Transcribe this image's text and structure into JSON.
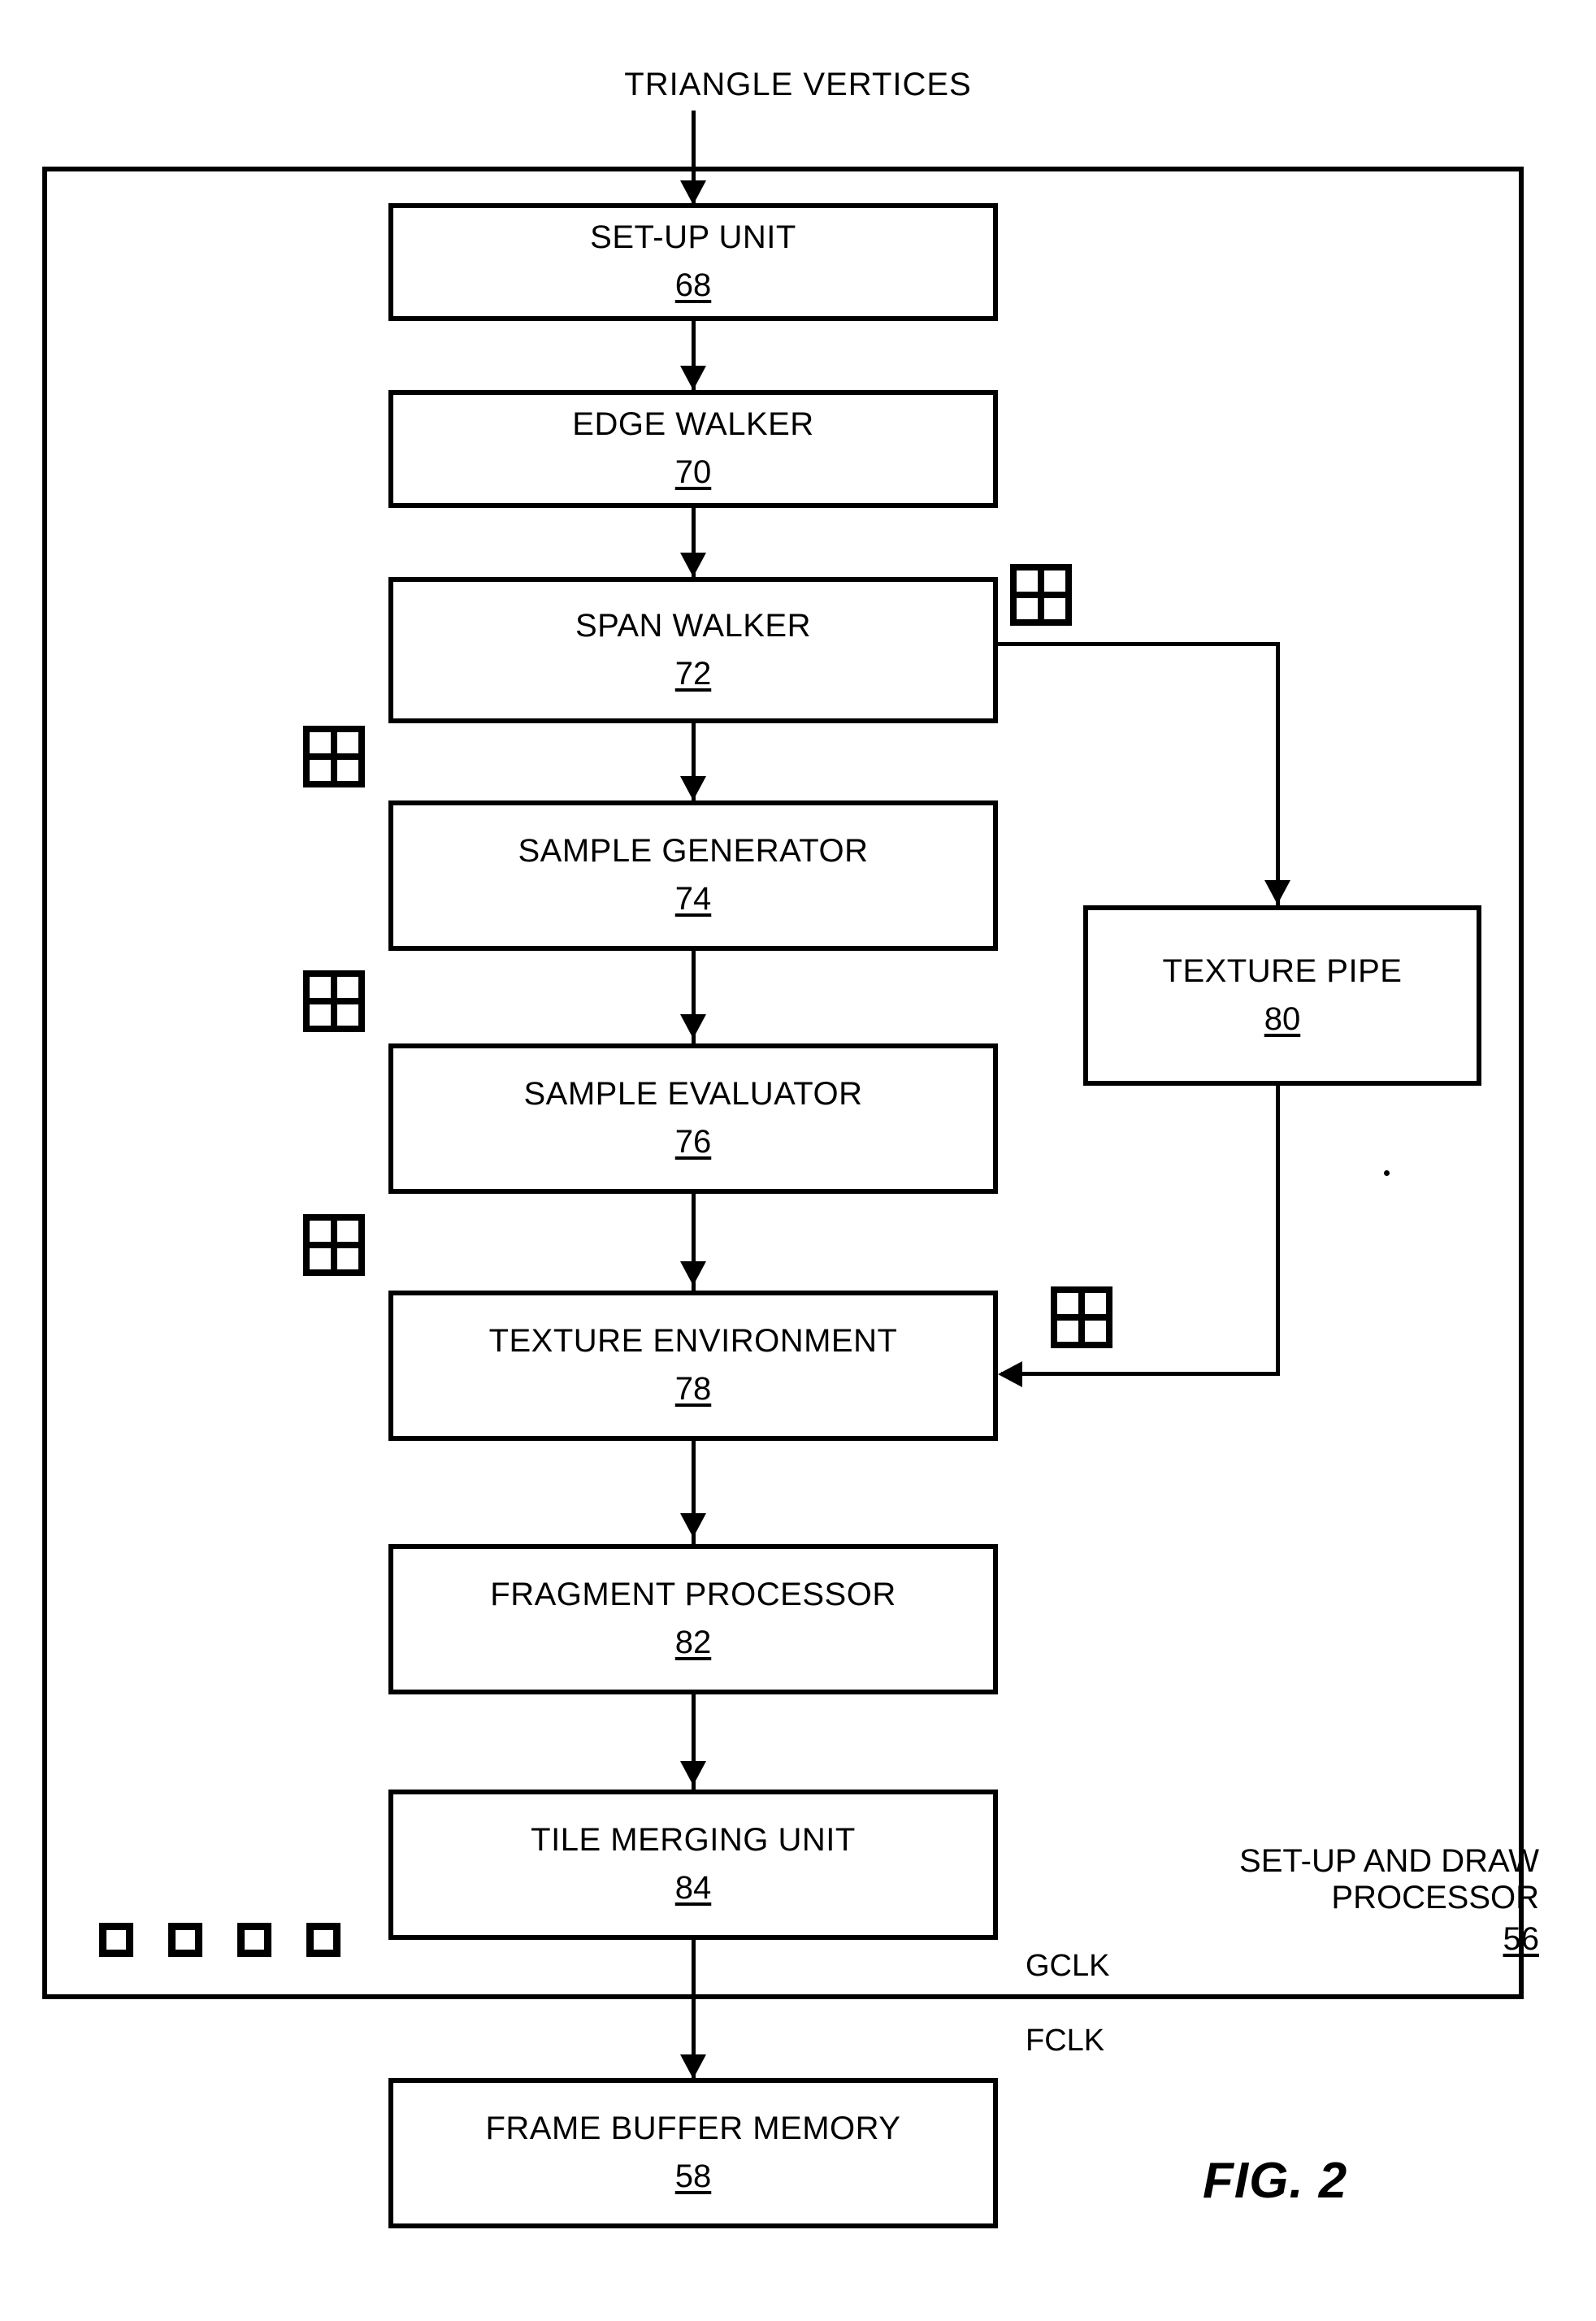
{
  "figure": {
    "caption": "FIG. 2",
    "input_label": "TRIANGLE VERTICES"
  },
  "container": {
    "label_line1": "SET-UP AND DRAW",
    "label_line2": "PROCESSOR",
    "ref_number": "56"
  },
  "clocks": {
    "gclk": "GCLK",
    "fclk": "FCLK"
  },
  "blocks": [
    {
      "title": "SET-UP UNIT",
      "ref": "68"
    },
    {
      "title": "EDGE WALKER",
      "ref": "70"
    },
    {
      "title": "SPAN WALKER",
      "ref": "72"
    },
    {
      "title": "SAMPLE GENERATOR",
      "ref": "74"
    },
    {
      "title": "SAMPLE EVALUATOR",
      "ref": "76"
    },
    {
      "title": "TEXTURE ENVIRONMENT",
      "ref": "78"
    },
    {
      "title": "FRAGMENT PROCESSOR",
      "ref": "82"
    },
    {
      "title": "TILE MERGING UNIT",
      "ref": "84"
    },
    {
      "title": "TEXTURE PIPE",
      "ref": "80"
    },
    {
      "title": "FRAME BUFFER MEMORY",
      "ref": "58"
    }
  ],
  "icons": {
    "grid": "sample-tile-grid-icon",
    "square": "pixel-square-icon"
  },
  "colors": {
    "line": "#000000",
    "background": "#ffffff"
  }
}
